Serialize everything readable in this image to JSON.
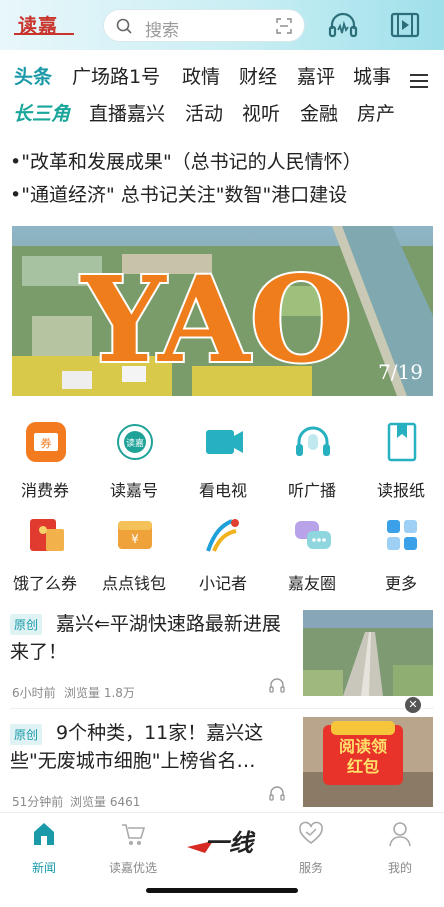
{
  "header": {
    "logo_text": "读嘉",
    "search_placeholder": "搜索",
    "icons": [
      "headset-icon",
      "video-icon",
      "scan-icon",
      "search-icon"
    ]
  },
  "nav": {
    "row1": [
      "头条",
      "广场路1号",
      "政情",
      "财经",
      "嘉评",
      "城事"
    ],
    "row2": [
      "长三角",
      "直播嘉兴",
      "活动",
      "视听",
      "金融",
      "房产"
    ]
  },
  "headlines": [
    "•\"改革和发展成果\"（总书记的人民情怀）",
    "•\"通道经济\"  总书记关注\"数智\"港口建设"
  ],
  "banner": {
    "text": "YAO",
    "counter": "7/19"
  },
  "grid": [
    {
      "label": "消费券",
      "icon": "coupon-icon"
    },
    {
      "label": "读嘉号",
      "icon": "dujia-account-icon"
    },
    {
      "label": "看电视",
      "icon": "tv-icon"
    },
    {
      "label": "听广播",
      "icon": "radio-icon"
    },
    {
      "label": "读报纸",
      "icon": "newspaper-icon"
    },
    {
      "label": "饿了么券",
      "icon": "eleme-coupon-icon"
    },
    {
      "label": "点点钱包",
      "icon": "wallet-icon"
    },
    {
      "label": "小记者",
      "icon": "reporter-icon"
    },
    {
      "label": "嘉友圈",
      "icon": "chat-circle-icon"
    },
    {
      "label": "更多",
      "icon": "more-icon"
    }
  ],
  "news": [
    {
      "badge": "原创",
      "title": "嘉兴⇐平湖快速路最新进展来了！",
      "time": "6小时前",
      "views": "浏览量 1.8万"
    },
    {
      "badge": "原创",
      "title": "9个种类，11家！嘉兴这些\"无废城市细胞\"上榜省名…",
      "time": "51分钟前",
      "views": "浏览量 6461",
      "ad_text": "阅读领红包"
    }
  ],
  "tabbar": [
    {
      "label": "新闻",
      "icon": "home-icon",
      "active": true
    },
    {
      "label": "读嘉优选",
      "icon": "cart-icon",
      "active": false
    },
    {
      "label": "一线",
      "icon": "yixian-logo-icon",
      "active": false
    },
    {
      "label": "服务",
      "icon": "heart-icon",
      "active": false
    },
    {
      "label": "我的",
      "icon": "user-icon",
      "active": false
    }
  ],
  "colors": {
    "accent": "#1a9aa8",
    "brand_red": "#c8332b",
    "banner_orange": "#f07d1c"
  }
}
